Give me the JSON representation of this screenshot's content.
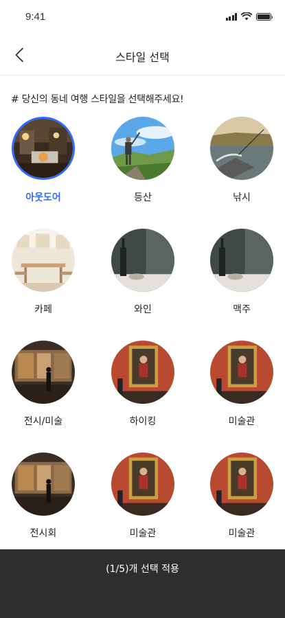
{
  "status_bar": {
    "time": "9:41",
    "icons": [
      "signal-icon",
      "wifi-icon",
      "battery-icon"
    ]
  },
  "nav": {
    "back_icon": "chevron-left-icon",
    "title": "스타일 선택"
  },
  "instruction": "# 당신의 동네 여행 스타일을 선택해주세요!",
  "styles": [
    {
      "label": "아웃도어",
      "selected": true,
      "image": "camping-icon"
    },
    {
      "label": "등산",
      "selected": false,
      "image": "hiking-icon"
    },
    {
      "label": "낚시",
      "selected": false,
      "image": "fishing-icon"
    },
    {
      "label": "카페",
      "selected": false,
      "image": "cafe-icon"
    },
    {
      "label": "와인",
      "selected": false,
      "image": "wine-icon"
    },
    {
      "label": "맥주",
      "selected": false,
      "image": "beer-icon"
    },
    {
      "label": "전시/미술",
      "selected": false,
      "image": "exhibition-icon"
    },
    {
      "label": "하이킹",
      "selected": false,
      "image": "painting-icon"
    },
    {
      "label": "미술관",
      "selected": false,
      "image": "painting-icon"
    },
    {
      "label": "전시회",
      "selected": false,
      "image": "exhibition-icon"
    },
    {
      "label": "미술관",
      "selected": false,
      "image": "painting-icon"
    },
    {
      "label": "미술관",
      "selected": false,
      "image": "painting-icon"
    }
  ],
  "apply_button": {
    "label": "(1/5)개 선택 적용"
  },
  "colors": {
    "accent": "#2f6bff",
    "footer": "#2e2e2e"
  }
}
